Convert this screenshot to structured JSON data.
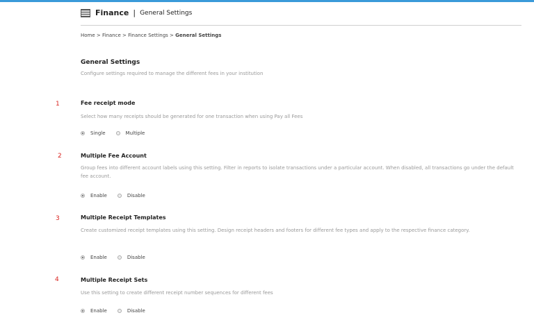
{
  "header": {
    "module": "Finance",
    "separator": "|",
    "page": "General Settings"
  },
  "breadcrumb": {
    "path": "Home > Finance > Finance Settings > ",
    "current": "General Settings"
  },
  "page": {
    "title": "General Settings",
    "description": "Configure settings required to manage the different fees in your institution"
  },
  "settings": [
    {
      "number": "1",
      "title": "Fee receipt mode",
      "description": "Select how many receipts should be generated for one transaction when using Pay all Fees",
      "options": [
        "Single",
        "Multiple"
      ]
    },
    {
      "number": "2",
      "title": "Multiple Fee Account",
      "description": "Group fees into different account labels using this setting. Filter in reports to isolate transactions under a particular account. When disabled, all transactions go under the default fee account.",
      "options": [
        "Enable",
        "Disable"
      ]
    },
    {
      "number": "3",
      "title": "Multiple Receipt Templates",
      "description": "Create customized receipt templates using this setting. Design receipt headers and footers for different fee types and apply to the respective finance category.",
      "options": [
        "Enable",
        "Disable"
      ]
    },
    {
      "number": "4",
      "title": "Multiple Receipt Sets",
      "description": "Use this setting to create different receipt number sequences for different fees",
      "options": [
        "Enable",
        "Disable"
      ]
    }
  ],
  "colors": {
    "accent": "#3a9ad9",
    "number": "#d9231f"
  }
}
